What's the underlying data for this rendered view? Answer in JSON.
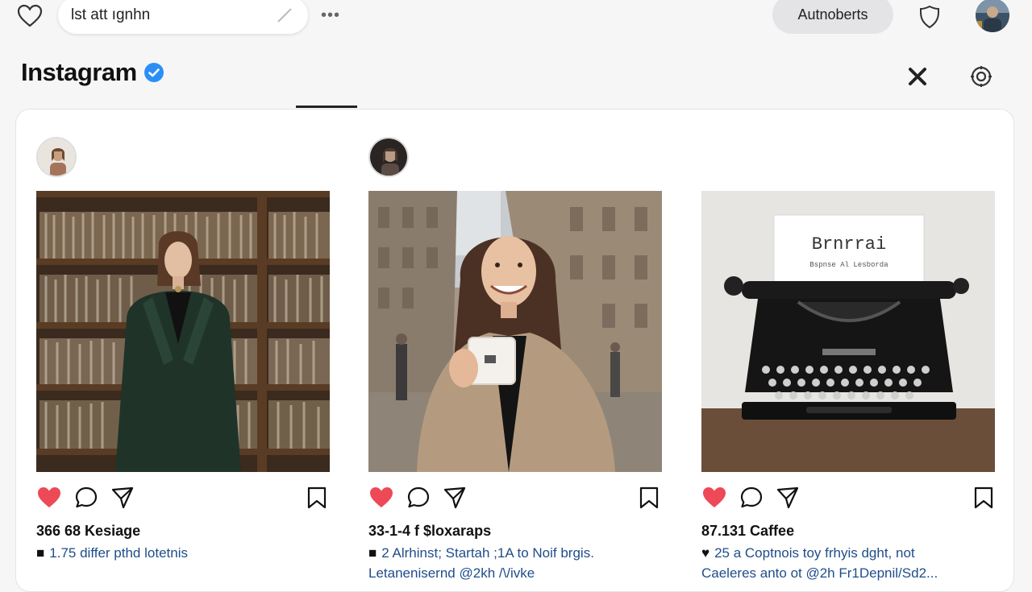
{
  "topbar": {
    "search_value": "lst att ıgnhn",
    "more_label": "•••",
    "user_pill": "Autnoberts"
  },
  "header": {
    "brand": "Instagram"
  },
  "posts": [
    {
      "likes": "366 68 Kesiage",
      "caption_lead": "■",
      "caption": "1.75 differ pthd lotetnis",
      "caption_line2": "",
      "image_subject": "woman in dark coat in front of bookshelves"
    },
    {
      "likes": "33-1-4 f $loxaraps",
      "caption_lead": "■",
      "caption": "2 Alrhinst; Startah ;1A to Noif brgis.",
      "caption_line2": "Letanenisernd @2kh /\\/ivke",
      "image_subject": "smiling woman holding coffee cup on city street"
    },
    {
      "likes": "87.131 Caffee",
      "caption_lead": "♥",
      "caption": "25 a Coptnois toy frhyis dght, not",
      "caption_line2": "Caeleres anto ot @2h Fr1Depnil/Sd2...",
      "image_subject": "vintage typewriter with paper",
      "paper_title": "Brnrrai",
      "paper_sub": "Bspnse Al Lesborda"
    }
  ],
  "colors": {
    "verified": "#2b8ff5",
    "like_red": "#ed4956",
    "caption_link": "#1f4d8a"
  },
  "icons": [
    "heart-icon",
    "search-edit-icon",
    "more-icon",
    "shield-icon",
    "verified-icon",
    "sparkle-icon",
    "settings-icon",
    "comment-icon",
    "share-icon",
    "bookmark-icon"
  ]
}
